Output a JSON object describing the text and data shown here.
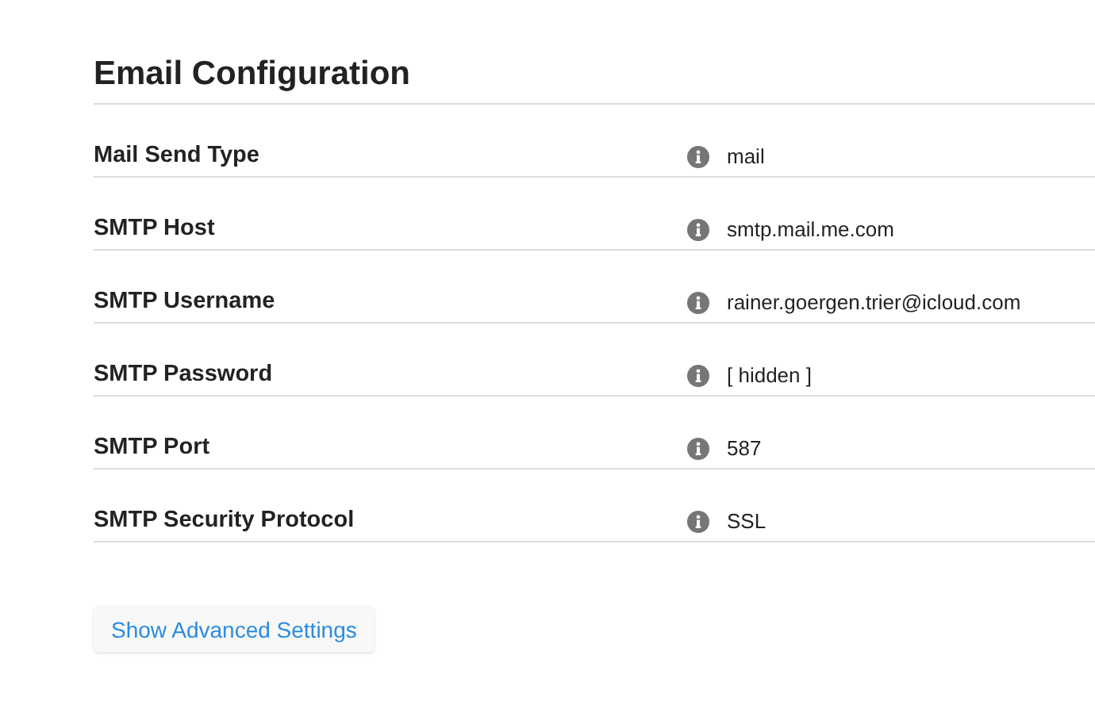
{
  "section": {
    "title": "Email Configuration"
  },
  "settings": [
    {
      "label": "Mail Send Type",
      "value": "mail"
    },
    {
      "label": "SMTP Host",
      "value": "smtp.mail.me.com"
    },
    {
      "label": "SMTP Username",
      "value": "rainer.goergen.trier@icloud.com"
    },
    {
      "label": "SMTP Password",
      "value": "[ hidden ]"
    },
    {
      "label": "SMTP Port",
      "value": "587"
    },
    {
      "label": "SMTP Security Protocol",
      "value": "SSL"
    }
  ],
  "buttons": [
    {
      "label": "Show Advanced Settings"
    }
  ]
}
